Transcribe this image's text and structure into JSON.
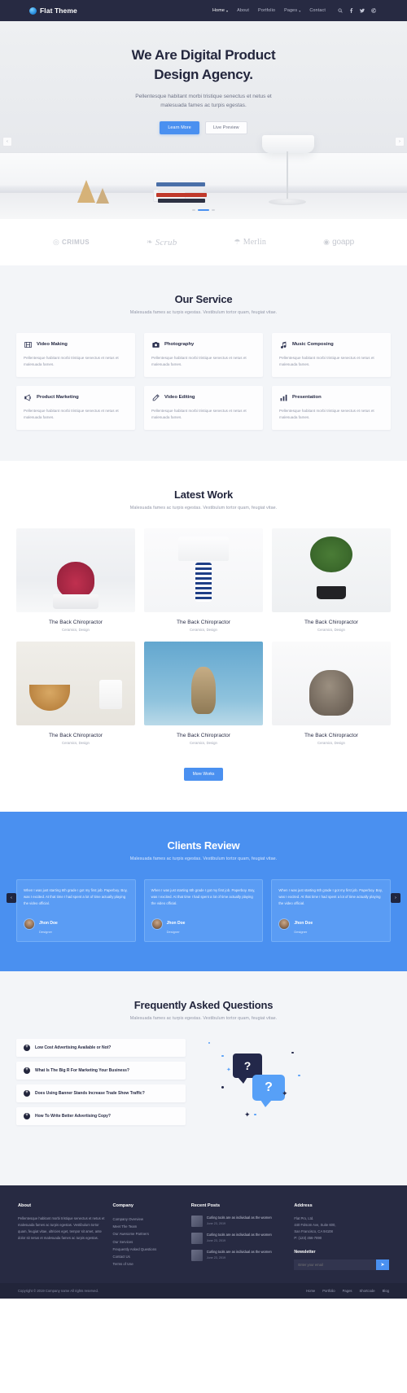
{
  "nav": {
    "brand": "Flat Theme",
    "links": [
      {
        "label": "Home",
        "caret": "▾",
        "active": true
      },
      {
        "label": "About",
        "caret": "",
        "active": false
      },
      {
        "label": "Portfolio",
        "caret": "",
        "active": false
      },
      {
        "label": "Pages",
        "caret": "▾",
        "active": false
      },
      {
        "label": "Contact",
        "caret": "",
        "active": false
      }
    ],
    "icons": [
      "search-icon",
      "facebook-icon",
      "twitter-icon",
      "dribbble-icon"
    ]
  },
  "hero": {
    "title_line1": "We Are Digital Product",
    "title_line2": "Design Agency.",
    "subtitle": "Pellentesque habitant morbi tristique senectus et netus et malesuada fames ac turpis egestas.",
    "primary_button": "Learn More",
    "secondary_button": "Live Preview",
    "prev_arrow": "‹",
    "next_arrow": "›"
  },
  "clients": [
    {
      "name": "CRIMUS",
      "mark": "◎"
    },
    {
      "name": "Scrub",
      "mark": "❧"
    },
    {
      "name": "Merlin",
      "mark": "☂"
    },
    {
      "name": "goapp",
      "mark": "◉"
    }
  ],
  "services": {
    "title": "Our Service",
    "subtitle": "Malesuada fames ac turpis egestas. Vestibulum tortor quam, feugiat vitae.",
    "items": [
      {
        "icon": "film-icon",
        "name": "Video Making",
        "text": "Pellentesque habitant morbi tristique senectus et netus et malesuada fames."
      },
      {
        "icon": "camera-icon",
        "name": "Photography",
        "text": "Pellentesque habitant morbi tristique senectus et netus et malesuada fames."
      },
      {
        "icon": "music-note-icon",
        "name": "Music Composing",
        "text": "Pellentesque habitant morbi tristique senectus et netus et malesuada fames."
      },
      {
        "icon": "megaphone-icon",
        "name": "Product Marketing",
        "text": "Pellentesque habitant morbi tristique senectus et netus et malesuada fames."
      },
      {
        "icon": "pen-icon",
        "name": "Video Editing",
        "text": "Pellentesque habitant morbi tristique senectus et netus et malesuada fames."
      },
      {
        "icon": "bar-chart-icon",
        "name": "Presentation",
        "text": "Pellentesque habitant morbi tristique senectus et netus et malesuada fames."
      }
    ]
  },
  "work": {
    "title": "Latest Work",
    "subtitle": "Malesuada fames ac turpis egestas. Vestibulum tortor quam, feugiat vitae.",
    "more_button": "More Works",
    "items": [
      {
        "title": "The Back Chiropractor",
        "meta": "Ceramics, Design"
      },
      {
        "title": "The Back Chiropractor",
        "meta": "Ceramics, Design"
      },
      {
        "title": "The Back Chiropractor",
        "meta": "Ceramics, Design"
      },
      {
        "title": "The Back Chiropractor",
        "meta": "Ceramics, Design"
      },
      {
        "title": "The Back Chiropractor",
        "meta": "Ceramics, Design"
      },
      {
        "title": "The Back Chiropractor",
        "meta": "Ceramics, Design"
      }
    ]
  },
  "reviews": {
    "title": "Clients Review",
    "subtitle": "Malesuada fames ac turpis egestas. Vestibulum tortor quam, feugiat vitae.",
    "prev_arrow": "‹",
    "next_arrow": "›",
    "items": [
      {
        "text": "When I was just starting 6th grade I got my first job. Paperboy. Boy, was I excited. At that time I had spent a lot of time actually playing the video official.",
        "name": "Jhon Doe",
        "role": "Designer"
      },
      {
        "text": "When I was just starting 6th grade I got my first job. Paperboy. Boy, was I excited. At that time I had spent a lot of time actually playing the video official.",
        "name": "Jhon Doe",
        "role": "Designer"
      },
      {
        "text": "When I was just starting 6th grade I got my first job. Paperboy. Boy, was I excited. At that time I had spent a lot of time actually playing the video official.",
        "name": "Jhon Doe",
        "role": "Designer"
      }
    ]
  },
  "faq": {
    "title": "Frequently Asked Questions",
    "subtitle": "Malesuada fames ac turpis egestas. Vestibulum tortor quam, feugiat vitae.",
    "plus": "+",
    "items": [
      {
        "question": "Low Cost Advertising Available or Not?"
      },
      {
        "question": "What Is The Big R For Marketing Your Business?"
      },
      {
        "question": "Does Using Banner Stands Increase Trade Show Traffic?"
      },
      {
        "question": "How To Write Better Advertising Copy?"
      }
    ],
    "bubble_dark_glyph": "?",
    "bubble_blue_glyph": "?"
  },
  "footer": {
    "about": {
      "heading": "About",
      "text": "Pellentesque habitant morbi tristique senectus et netus et malesuada fames ac turpis egestas. Vestibulum tortor quam, feugiat vitae, ultricies eget, tempor sit amet, ante dolor sit netus et malesuada fames ac turpis egestas."
    },
    "company": {
      "heading": "Company",
      "links": [
        "Company Overview",
        "Meet The Team",
        "Our Awesome Partners",
        "Our Services",
        "Frequently Asked Questions",
        "Contact Us",
        "Terms of Use"
      ]
    },
    "recent": {
      "heading": "Recent Posts",
      "posts": [
        {
          "title": "Curling tools are as individual as the women",
          "date": "June 23, 2019"
        },
        {
          "title": "Curling tools are as individual as the women",
          "date": "June 23, 2019"
        },
        {
          "title": "Curling tools are as individual as the women",
          "date": "June 23, 2019"
        }
      ]
    },
    "address": {
      "heading": "Address",
      "company": "Flat Pro, Ltd.",
      "line1": "440 Folsom Ave, Suite 600,",
      "line2": "San Francisco, CA 94108",
      "phone": "P: (123) 456-7890",
      "newsletter_heading": "Newsletter",
      "newsletter_placeholder": "Enter your email",
      "newsletter_button": "➤"
    }
  },
  "copyright": {
    "text": "Copyright © 2019 Company name All rights reserved.",
    "links": [
      "Home",
      "Portfolio",
      "Pages",
      "Shortcode",
      "Blog"
    ]
  },
  "colors": {
    "accent": "#4a90f0",
    "dark": "#272a42",
    "muted": "#9297a8"
  }
}
